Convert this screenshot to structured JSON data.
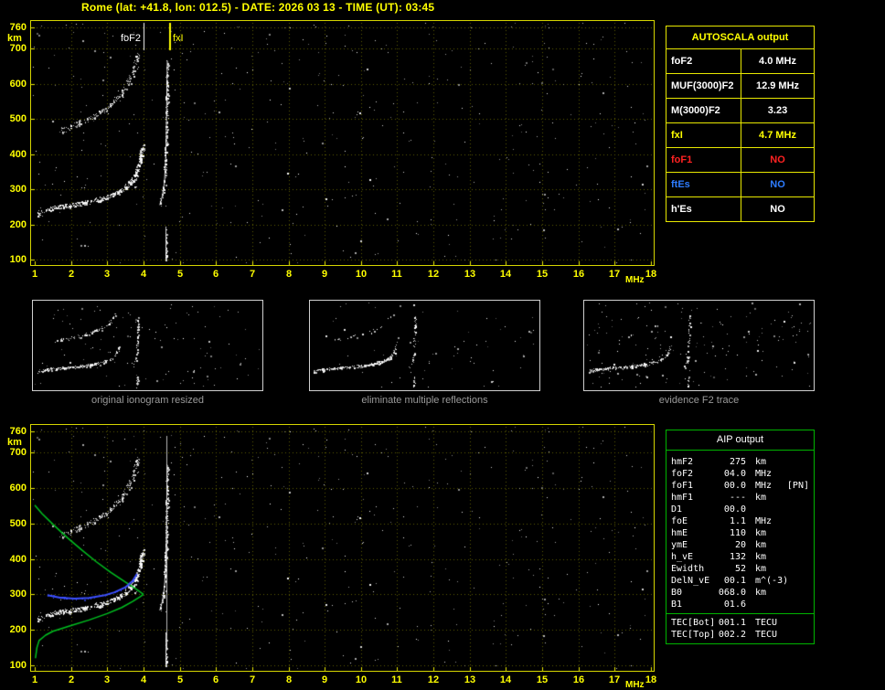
{
  "title": "Rome (lat: +41.8, lon: 012.5) - DATE: 2026 03 13 - TIME (UT): 03:45",
  "colors": {
    "axis_yellow": "#ffff00",
    "table_border_yellow": "#e8e800",
    "aip_green": "#00b400",
    "profile_green": "#00c020",
    "restored_blue": "#3c50ff",
    "no_red": "#ff2222",
    "es_blue": "#2e7cff",
    "caption_gray": "#9a9a9a"
  },
  "top_plot": {
    "y_unit": "km",
    "x_unit": "MHz",
    "foF2_label": "foF2",
    "fxI_label": "fxI"
  },
  "bottom_plot": {
    "y_unit": "km",
    "x_unit": "MHz"
  },
  "autoscala_table": {
    "header": "AUTOSCALA output",
    "rows": [
      {
        "label": "foF2",
        "value": "4.0 MHz",
        "color": "#ffffff"
      },
      {
        "label": "MUF(3000)F2",
        "value": "12.9 MHz",
        "color": "#ffffff"
      },
      {
        "label": "M(3000)F2",
        "value": "3.23",
        "color": "#ffffff"
      },
      {
        "label": "fxI",
        "value": "4.7 MHz",
        "color": "#ffff00"
      },
      {
        "label": "foF1",
        "value": "NO",
        "color": "#ff2222"
      },
      {
        "label": "ftEs",
        "value": "NO",
        "color": "#2e7cff"
      },
      {
        "label": "h'Es",
        "value": "NO",
        "color": "#ffffff"
      }
    ]
  },
  "thumbnails": [
    {
      "caption": "original ionogram resized"
    },
    {
      "caption": "eliminate multiple reflections"
    },
    {
      "caption": "evidence F2 trace"
    }
  ],
  "aip_table": {
    "header": "AIP output",
    "rows": [
      {
        "name": "hmF2",
        "value": "275",
        "unit": "km",
        "extra": ""
      },
      {
        "name": "foF2",
        "value": "04.0",
        "unit": "MHz",
        "extra": ""
      },
      {
        "name": "foF1",
        "value": "00.0",
        "unit": "MHz",
        "extra": "[PN]"
      },
      {
        "name": "hmF1",
        "value": "---",
        "unit": "km",
        "extra": ""
      },
      {
        "name": "D1",
        "value": "00.0",
        "unit": "",
        "extra": ""
      },
      {
        "name": "foE",
        "value": "1.1",
        "unit": "MHz",
        "extra": ""
      },
      {
        "name": "hmE",
        "value": "110",
        "unit": "km",
        "extra": ""
      },
      {
        "name": "ymE",
        "value": "20",
        "unit": "km",
        "extra": ""
      },
      {
        "name": "h_vE",
        "value": "132",
        "unit": "km",
        "extra": ""
      },
      {
        "name": "Ewidth",
        "value": "52",
        "unit": "km",
        "extra": ""
      },
      {
        "name": "DelN_vE",
        "value": "00.1",
        "unit": "m^(-3)",
        "extra": ""
      },
      {
        "name": "B0",
        "value": "068.0",
        "unit": "km",
        "extra": ""
      },
      {
        "name": "B1",
        "value": "01.6",
        "unit": "",
        "extra": ""
      }
    ],
    "tec_rows": [
      {
        "name": "TEC[Bot]",
        "value": "001.1",
        "unit": "TECU"
      },
      {
        "name": "TEC[Top]",
        "value": "002.2",
        "unit": "TECU"
      }
    ]
  },
  "chart_data": {
    "ionogram": {
      "type": "scatter",
      "xlabel": "MHz",
      "ylabel": "km",
      "xlim": [
        1,
        18
      ],
      "ylim": [
        100,
        760
      ],
      "x_ticks": [
        1,
        2,
        3,
        4,
        5,
        6,
        7,
        8,
        9,
        10,
        11,
        12,
        13,
        14,
        15,
        16,
        17,
        18
      ],
      "y_ticks": [
        760,
        700,
        600,
        500,
        400,
        300,
        200,
        100
      ],
      "grid": true,
      "traces": {
        "f_trace": [
          [
            1.05,
            230
          ],
          [
            1.3,
            240
          ],
          [
            1.6,
            248
          ],
          [
            2.0,
            255
          ],
          [
            2.4,
            262
          ],
          [
            2.8,
            272
          ],
          [
            3.1,
            283
          ],
          [
            3.4,
            298
          ],
          [
            3.6,
            315
          ],
          [
            3.75,
            335
          ],
          [
            3.85,
            360
          ],
          [
            3.93,
            395
          ],
          [
            3.98,
            425
          ]
        ],
        "x_trace": [
          [
            4.45,
            255
          ],
          [
            4.52,
            280
          ],
          [
            4.58,
            320
          ],
          [
            4.61,
            380
          ],
          [
            4.63,
            450
          ],
          [
            4.64,
            530
          ],
          [
            4.65,
            610
          ],
          [
            4.66,
            665
          ]
        ],
        "x_trace_low": [
          [
            4.62,
            100
          ],
          [
            4.62,
            190
          ]
        ],
        "second_hop": [
          [
            1.7,
            465
          ],
          [
            2.0,
            480
          ],
          [
            2.4,
            497
          ],
          [
            2.8,
            517
          ],
          [
            3.1,
            540
          ],
          [
            3.4,
            572
          ],
          [
            3.6,
            608
          ],
          [
            3.75,
            648
          ],
          [
            3.85,
            688
          ]
        ]
      }
    },
    "top_overlays": {
      "foF2_marker_mhz": 4.0,
      "fxI_marker_mhz": 4.7
    },
    "bottom_overlays": {
      "fxI_line_mhz": 4.62,
      "profile_bottomside": [
        [
          1.02,
          120
        ],
        [
          1.06,
          150
        ],
        [
          1.12,
          170
        ],
        [
          1.3,
          185
        ],
        [
          1.5,
          196
        ],
        [
          2.0,
          212
        ],
        [
          2.5,
          228
        ],
        [
          3.0,
          246
        ],
        [
          3.4,
          263
        ],
        [
          3.7,
          280
        ],
        [
          3.9,
          293
        ],
        [
          4.0,
          300
        ]
      ],
      "profile_topside": [
        [
          4.0,
          300
        ],
        [
          3.8,
          315
        ],
        [
          3.5,
          335
        ],
        [
          3.1,
          362
        ],
        [
          2.7,
          392
        ],
        [
          2.3,
          425
        ],
        [
          1.9,
          460
        ],
        [
          1.5,
          498
        ],
        [
          1.2,
          528
        ],
        [
          1.0,
          552
        ]
      ],
      "restored_trace": [
        [
          1.35,
          298
        ],
        [
          1.7,
          291
        ],
        [
          2.1,
          288
        ],
        [
          2.5,
          290
        ],
        [
          2.9,
          297
        ],
        [
          3.2,
          306
        ],
        [
          3.5,
          320
        ],
        [
          3.7,
          338
        ],
        [
          3.82,
          358
        ]
      ]
    },
    "thumbnails": {
      "xlim": [
        1,
        9
      ]
    }
  }
}
